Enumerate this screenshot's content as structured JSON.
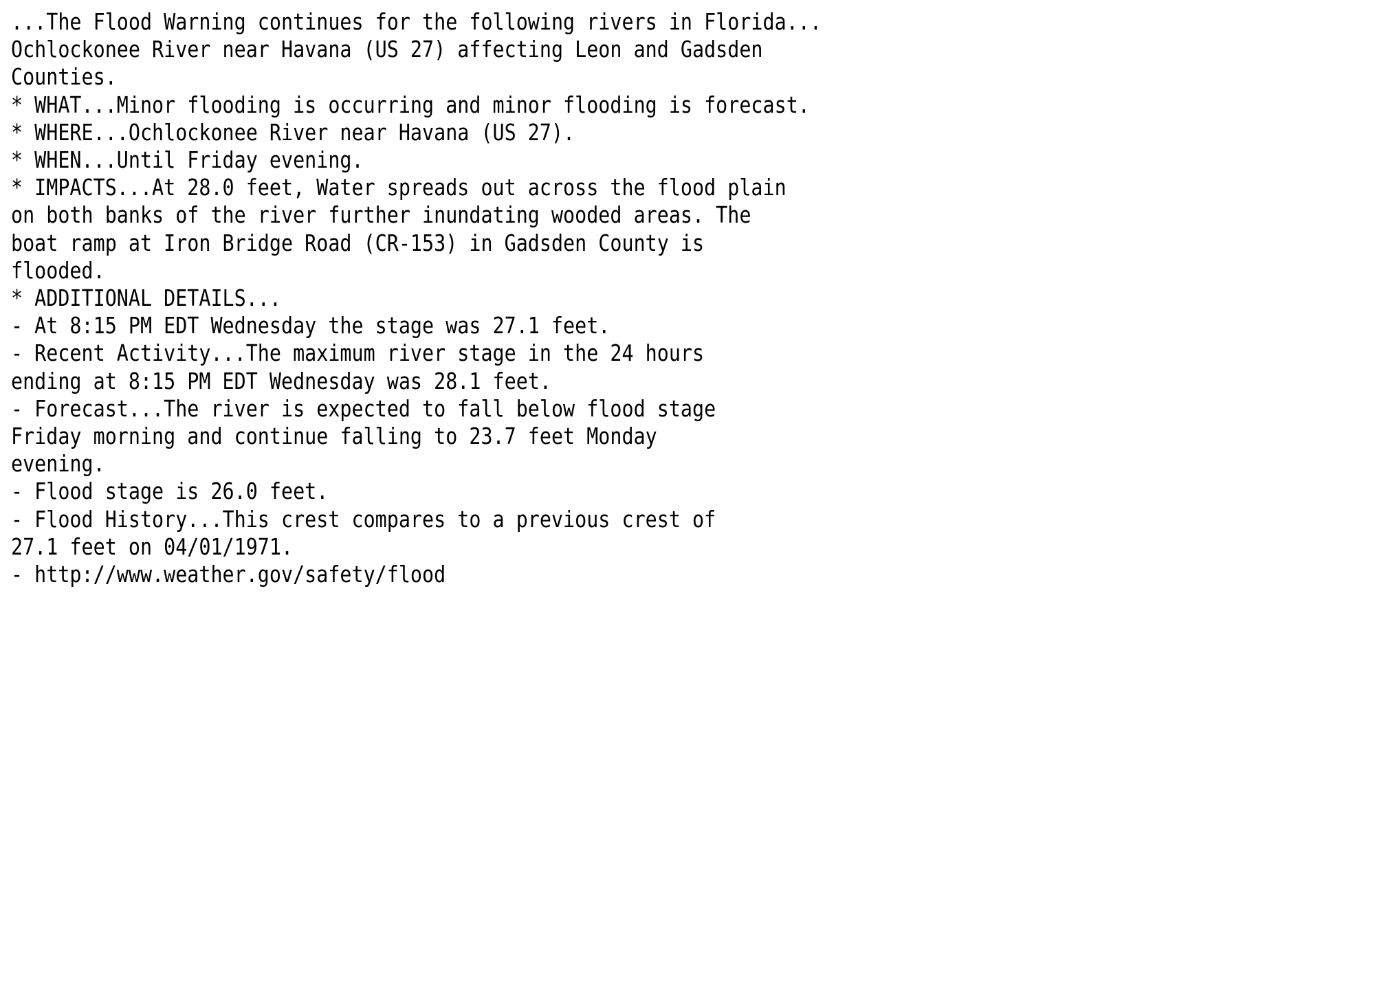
{
  "document": {
    "type": "nws-text-bulletin",
    "product": "Flood Warning",
    "background_color": "#ffffff",
    "text_color": "#000000",
    "headline": "...The Flood Warning continues for the following rivers in Florida...",
    "lines": [
      "...The Flood Warning continues for the following rivers in Florida...",
      "",
      "Ochlockonee River near Havana (US 27) affecting Leon and Gadsden",
      "Counties.",
      "",
      "* WHAT...Minor flooding is occurring and minor flooding is forecast.",
      "",
      "* WHERE...Ochlockonee River near Havana (US 27).",
      "",
      "* WHEN...Until Friday evening.",
      "",
      "* IMPACTS...At 28.0 feet, Water spreads out across the flood plain",
      "on both banks of the river further inundating wooded areas. The",
      "boat ramp at Iron Bridge Road (CR-153) in Gadsden County is",
      "flooded.",
      "",
      "* ADDITIONAL DETAILS...",
      "- At 8:15 PM EDT Wednesday the stage was 27.1 feet.",
      "- Recent Activity...The maximum river stage in the 24 hours",
      "ending at 8:15 PM EDT Wednesday was 28.1 feet.",
      "- Forecast...The river is expected to fall below flood stage",
      "Friday morning and continue falling to 23.7 feet Monday",
      "evening.",
      "- Flood stage is 26.0 feet.",
      "- Flood History...This crest compares to a previous crest of",
      "27.1 feet on 04/01/1971.",
      "- http://www.weather.gov/safety/flood"
    ],
    "sections": {
      "river_location": "Ochlockonee River near Havana (US 27) affecting Leon and Gadsden Counties.",
      "what": "Minor flooding is occurring and minor flooding is forecast.",
      "where": "Ochlockonee River near Havana (US 27).",
      "when": "Until Friday evening.",
      "impacts": "At 28.0 feet, Water spreads out across the flood plain on both banks of the river further inundating wooded areas. The boat ramp at Iron Bridge Road (CR-153) in Gadsden County is flooded.",
      "additional_details_label": "* ADDITIONAL DETAILS...",
      "details": [
        "At 8:15 PM EDT Wednesday the stage was 27.1 feet.",
        "Recent Activity...The maximum river stage in the 24 hours ending at 8:15 PM EDT Wednesday was 28.1 feet.",
        "Forecast...The river is expected to fall below flood stage Friday morning and continue falling to 23.7 feet Monday evening.",
        "Flood stage is 26.0 feet.",
        "Flood History...This crest compares to a previous crest of 27.1 feet on 04/01/1971.",
        "http://www.weather.gov/safety/flood"
      ]
    },
    "values": {
      "impact_stage_feet": "28.0",
      "observation_time": "8:15 PM EDT Wednesday",
      "current_stage_feet": "27.1",
      "max_stage_24h_feet": "28.1",
      "forecast_fall_to_feet": "23.7",
      "forecast_fall_day": "Monday evening",
      "flood_stage_feet": "26.0",
      "previous_crest_feet": "27.1",
      "previous_crest_date": "04/01/1971",
      "safety_url": "http://www.weather.gov/safety/flood",
      "counties": "Leon and Gadsden",
      "state": "Florida",
      "river": "Ochlockonee River",
      "gauge": "near Havana (US 27)",
      "road_closure": "Iron Bridge Road (CR-153)"
    }
  }
}
